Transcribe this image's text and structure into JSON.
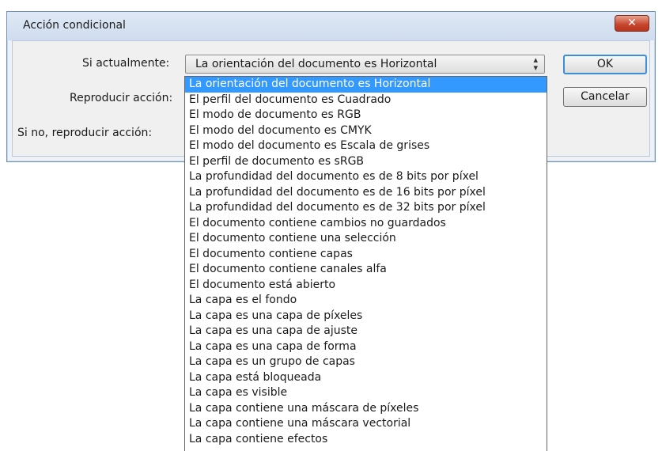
{
  "dialog": {
    "title": "Acción condicional",
    "close_label": "✕"
  },
  "form": {
    "if_label": "Si actualmente:",
    "play_label": "Reproducir acción:",
    "else_label": "Si no, reproducir acción:",
    "condition_value": "La orientación del documento es Horizontal",
    "arrow_icon": "updown-arrow-icon"
  },
  "buttons": {
    "ok": "OK",
    "cancel": "Cancelar"
  },
  "dropdown": {
    "selected_index": 0,
    "options": [
      "La orientación del documento es Horizontal",
      "El perfil del documento es Cuadrado",
      "El modo de documento es RGB",
      "El modo del documento es CMYK",
      "El modo del documento es Escala de grises",
      "El perfil de documento es sRGB",
      "La profundidad del documento es de 8 bits por píxel",
      "La profundidad del documento es de 16 bits por píxel",
      "La profundidad del documento es de 32 bits por píxel",
      "El documento contiene cambios no guardados",
      "El documento contiene una selección",
      "El documento contiene capas",
      "El documento contiene canales alfa",
      "El documento está abierto",
      "La capa es el fondo",
      "La capa es una capa de píxeles",
      "La capa es una capa de ajuste",
      "La capa es una capa de forma",
      "La capa es un grupo de capas",
      "La capa está bloqueada",
      "La capa es visible",
      "La capa contiene una máscara de píxeles",
      "La capa contiene una máscara vectorial",
      "La capa contiene efectos"
    ]
  },
  "colors": {
    "selection": "#3399ff",
    "close_button": "#c7442b",
    "ok_border": "#3c8fd6"
  }
}
